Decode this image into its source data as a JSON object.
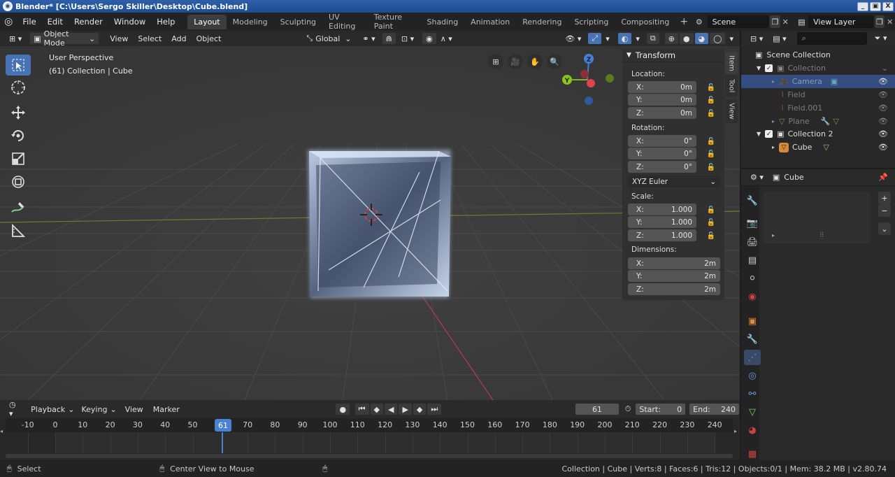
{
  "window": {
    "title": "Blender* [C:\\Users\\Sergo Skiller\\Desktop\\Cube.blend]",
    "controls": [
      "_",
      "▣",
      "X"
    ]
  },
  "topbar": {
    "menus": [
      "File",
      "Edit",
      "Render",
      "Window",
      "Help"
    ],
    "workspaces": [
      "Layout",
      "Modeling",
      "Sculpting",
      "UV Editing",
      "Texture Paint",
      "Shading",
      "Animation",
      "Rendering",
      "Scripting",
      "Compositing"
    ],
    "active_workspace": "Layout",
    "add_tab": "+",
    "scene": "Scene",
    "view_layer": "View Layer"
  },
  "viewport_header": {
    "mode": "Object Mode",
    "menus": [
      "View",
      "Select",
      "Add",
      "Object"
    ],
    "orientation": "Global"
  },
  "viewport": {
    "perspective": "User Perspective",
    "collection_info": "(61) Collection | Cube",
    "gizmo_axes": {
      "z": "Z",
      "y": "Y"
    }
  },
  "npanel": {
    "header": "Transform",
    "location_label": "Location:",
    "location": [
      {
        "axis": "X:",
        "value": "0m"
      },
      {
        "axis": "Y:",
        "value": "0m"
      },
      {
        "axis": "Z:",
        "value": "0m"
      }
    ],
    "rotation_label": "Rotation:",
    "rotation": [
      {
        "axis": "X:",
        "value": "0°"
      },
      {
        "axis": "Y:",
        "value": "0°"
      },
      {
        "axis": "Z:",
        "value": "0°"
      }
    ],
    "rotation_mode": "XYZ Euler",
    "scale_label": "Scale:",
    "scale": [
      {
        "axis": "X:",
        "value": "1.000"
      },
      {
        "axis": "Y:",
        "value": "1.000"
      },
      {
        "axis": "Z:",
        "value": "1.000"
      }
    ],
    "dimensions_label": "Dimensions:",
    "dimensions": [
      {
        "axis": "X:",
        "value": "2m"
      },
      {
        "axis": "Y:",
        "value": "2m"
      },
      {
        "axis": "Z:",
        "value": "2m"
      }
    ],
    "tabs": [
      "Item",
      "Tool",
      "View"
    ]
  },
  "outliner": {
    "root": "Scene Collection",
    "items": [
      "Collection",
      "Camera",
      "Field",
      "Field.001",
      "Plane",
      "Collection 2",
      "Cube"
    ]
  },
  "properties": {
    "object_name": "Cube"
  },
  "timeline": {
    "menus": [
      "Playback",
      "Keying",
      "View",
      "Marker"
    ],
    "current_frame": "61",
    "start_label": "Start:",
    "start": "0",
    "end_label": "End:",
    "end": "240",
    "ruler": [
      "-10",
      "0",
      "10",
      "20",
      "30",
      "40",
      "50",
      "61",
      "70",
      "80",
      "90",
      "100",
      "110",
      "120",
      "130",
      "140",
      "150",
      "160",
      "170",
      "180",
      "190",
      "200",
      "210",
      "220",
      "230",
      "240"
    ]
  },
  "status": {
    "select": "Select",
    "center": "Center View to Mouse",
    "info": "Collection | Cube | Verts:8 | Faces:6 | Tris:12 | Objects:0/1 | Mem: 38.2 MB | v2.80.74"
  }
}
